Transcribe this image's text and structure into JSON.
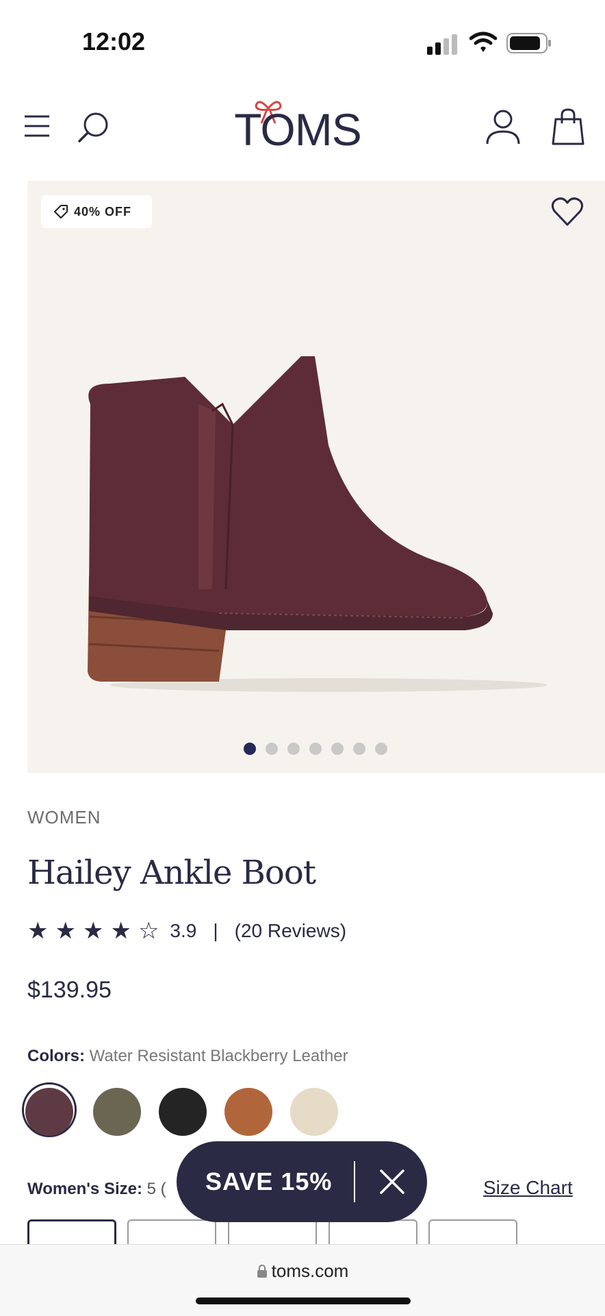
{
  "status_bar": {
    "time": "12:02"
  },
  "header": {
    "logo_text": "TOMS"
  },
  "hero": {
    "badge": "40% OFF",
    "dots_total": 7,
    "active_dot": 1
  },
  "product": {
    "category": "WOMEN",
    "title": "Hailey Ankle Boot",
    "rating": {
      "stars": 4,
      "value": "3.9",
      "separator": "|",
      "reviews": "(20 Reviews)"
    },
    "price": "$139.95",
    "colors_label": "Colors:",
    "colors_value": "Water Resistant Blackberry Leather",
    "swatches": [
      "#5e3a44",
      "#6b6652",
      "#242424",
      "#b0663a",
      "#e5dbc6"
    ],
    "size_label": "Women's Size:",
    "size_value": "5 (",
    "size_chart": "Size Chart"
  },
  "popup": {
    "text": "SAVE 15%"
  },
  "browser": {
    "url": "toms.com"
  },
  "colors": {
    "primary": "#2a2a45",
    "hero_bg": "#f6f3ee",
    "logo_bow": "#d64545"
  }
}
